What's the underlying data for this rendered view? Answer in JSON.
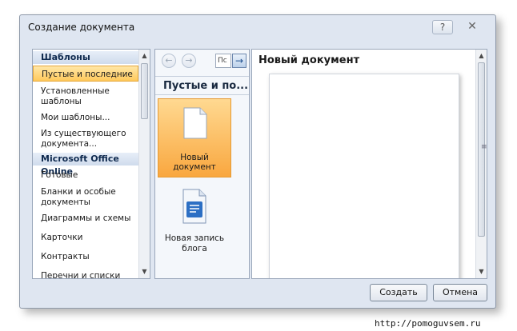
{
  "window": {
    "title": "Создание документа",
    "help": "?",
    "close": "✕"
  },
  "left_panel": {
    "headers": [
      "Шаблоны",
      "Microsoft Office Online"
    ],
    "items": [
      "Пустые и последние",
      "Установленные шаблоны",
      "Мои шаблоны...",
      "Из существующего документа..."
    ],
    "online_items": [
      "Готовые",
      "Бланки и особые документы",
      "Диаграммы и схемы",
      "Карточки",
      "Контракты",
      "Перечни и списки дел"
    ]
  },
  "middle_panel": {
    "search_value": "Пс",
    "heading": "Пустые и по...",
    "tiles": [
      {
        "label": "Новый документ",
        "icon": "blank-document-icon",
        "selected": true
      },
      {
        "label": "Новая запись блога",
        "icon": "blog-post-icon",
        "selected": false
      }
    ]
  },
  "preview": {
    "title": "Новый документ"
  },
  "buttons": {
    "create": "Создать",
    "cancel": "Отмена"
  },
  "footer": {
    "url": "http://pomoguvsem.ru"
  },
  "colors": {
    "selected_fill": "#ffc95c",
    "dialog_bg": "#dfe6f1",
    "header_text": "#0f2a4f"
  }
}
